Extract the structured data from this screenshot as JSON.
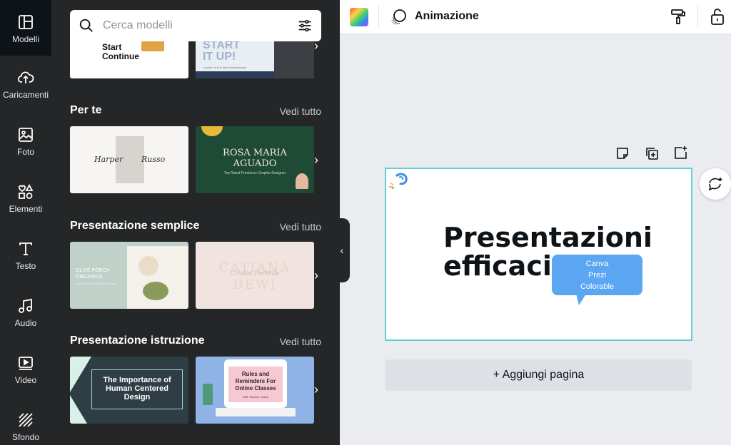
{
  "sidebar": {
    "items": [
      {
        "label": "Modelli",
        "icon": "templates-icon"
      },
      {
        "label": "Caricamenti",
        "icon": "upload-icon"
      },
      {
        "label": "Foto",
        "icon": "photo-icon"
      },
      {
        "label": "Elementi",
        "icon": "elements-icon"
      },
      {
        "label": "Testo",
        "icon": "text-icon"
      },
      {
        "label": "Audio",
        "icon": "music-icon"
      },
      {
        "label": "Video",
        "icon": "video-icon"
      },
      {
        "label": "Sfondo",
        "icon": "background-icon"
      }
    ]
  },
  "search": {
    "placeholder": "Cerca modelli"
  },
  "top_thumbs": {
    "first": {
      "line1": "Start",
      "line2": "Continue"
    },
    "second": {
      "line1": "START",
      "line2": "IT UP!",
      "subtitle": "A guide for first time entrepreneurs"
    }
  },
  "sections": [
    {
      "title": "Per te",
      "see_all": "Vedi tutto",
      "thumbs": [
        {
          "name1": "Harper",
          "name2": "Russo"
        },
        {
          "name1": "ROSA MARIA",
          "name2": "AGUADO",
          "subtitle": "Top Rated Freelance Graphic Designer"
        }
      ]
    },
    {
      "title": "Presentazione semplice",
      "see_all": "Vedi tutto",
      "thumbs": [
        {
          "line1": "OLIVE PORCH",
          "line2": "ORGANICS",
          "subtitle": "Fresh Harvest Delivery Service"
        },
        {
          "line1": "CATIANA",
          "line2": "Cristin Portelle",
          "line3": "DEWI"
        }
      ]
    },
    {
      "title": "Presentazione istruzione",
      "see_all": "Vedi tutto",
      "thumbs": [
        {
          "line1": "The Importance of",
          "line2": "Human Centered",
          "line3": "Design"
        },
        {
          "line1": "Rules and",
          "line2": "Reminders For",
          "line3": "Online Classes",
          "subtitle": "With Teacher Casey"
        }
      ]
    }
  ],
  "topbar": {
    "animation_label": "Animazione"
  },
  "slide": {
    "title_line1": "Presentazioni",
    "title_line2": "efficaci",
    "bubble": [
      "Canva",
      "Prezi",
      "Colorable"
    ]
  },
  "add_page_label": "+ Aggiungi pagina",
  "colors": {
    "rail": "#0e1318",
    "panel": "#252627",
    "canvas": "#ebecf0",
    "slide_border": "#5fd0d8",
    "bubble": "#5ba6f2"
  }
}
